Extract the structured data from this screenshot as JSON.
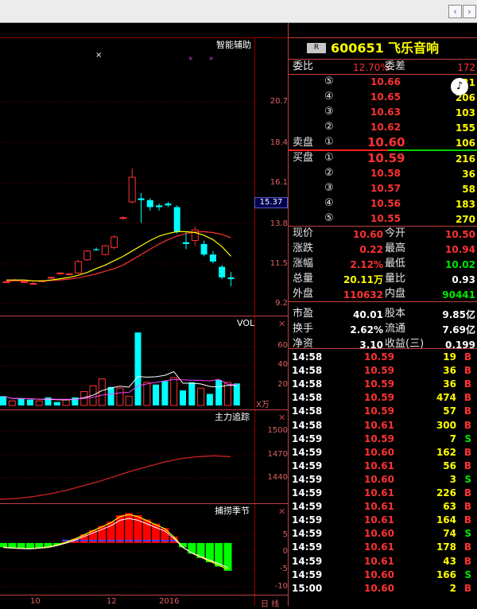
{
  "window": {
    "nav_back": "‹",
    "nav_forward": "›"
  },
  "chart_panels": {
    "main": {
      "title": "智能辅助",
      "ylabels": [
        "20.7",
        "18.4",
        "16.1",
        "13.8",
        "11.5",
        "9.2"
      ],
      "current_price_tag": "15.37",
      "marker": "×",
      "stars": [
        "*",
        "*"
      ]
    },
    "vol": {
      "title": "VOL",
      "ylabels": [
        "60",
        "40",
        "20"
      ],
      "unit": "X万"
    },
    "main_tracking": {
      "title": "主力追踪",
      "ylabels": [
        "1500",
        "1470",
        "1440"
      ]
    },
    "season": {
      "title": "捕捞季节",
      "ylabels": [
        "5",
        "0",
        "-5",
        "-10"
      ]
    },
    "close_glyph": "✕",
    "xlabels": [
      "10",
      "12",
      "2016"
    ],
    "period": "日 线"
  },
  "chart_data": [
    {
      "type": "candlestick",
      "title": "智能辅助",
      "ylim": [
        9.2,
        20.7
      ],
      "candles": [
        {
          "o": 10.45,
          "c": 10.45,
          "h": 10.5,
          "l": 10.4
        },
        {
          "o": 10.55,
          "c": 10.55,
          "h": 10.6,
          "l": 10.5
        },
        {
          "o": 10.45,
          "c": 10.45,
          "h": 10.5,
          "l": 10.4
        },
        {
          "o": 10.35,
          "c": 10.35,
          "h": 10.45,
          "l": 10.3
        },
        {
          "o": 10.5,
          "c": 10.5,
          "h": 10.55,
          "l": 10.45
        },
        {
          "o": 10.65,
          "c": 10.7,
          "h": 10.75,
          "l": 10.6
        },
        {
          "o": 10.9,
          "c": 10.95,
          "h": 11.0,
          "l": 10.85
        },
        {
          "o": 10.9,
          "c": 10.9,
          "h": 10.95,
          "l": 10.85
        },
        {
          "o": 10.95,
          "c": 11.6,
          "h": 11.7,
          "l": 10.9
        },
        {
          "o": 11.7,
          "c": 12.2,
          "h": 12.25,
          "l": 11.65
        },
        {
          "o": 12.3,
          "c": 12.25,
          "h": 12.4,
          "l": 12.2
        },
        {
          "o": 12.0,
          "c": 12.5,
          "h": 12.55,
          "l": 11.95
        },
        {
          "o": 12.4,
          "c": 13.0,
          "h": 13.1,
          "l": 12.3
        },
        {
          "o": 14.1,
          "c": 14.1,
          "h": 14.2,
          "l": 14.0
        },
        {
          "o": 15.0,
          "c": 16.4,
          "h": 16.9,
          "l": 14.9
        },
        {
          "o": 15.2,
          "c": 15.1,
          "h": 15.5,
          "l": 13.8
        },
        {
          "o": 15.1,
          "c": 14.7,
          "h": 15.2,
          "l": 14.5
        },
        {
          "o": 14.8,
          "c": 14.7,
          "h": 14.9,
          "l": 14.5
        },
        {
          "o": 14.9,
          "c": 14.8,
          "h": 15.0,
          "l": 14.7
        },
        {
          "o": 14.7,
          "c": 13.3,
          "h": 14.8,
          "l": 13.2
        },
        {
          "o": 12.7,
          "c": 12.6,
          "h": 13.3,
          "l": 12.3
        },
        {
          "o": 12.8,
          "c": 13.4,
          "h": 13.6,
          "l": 12.5
        },
        {
          "o": 12.6,
          "c": 12.0,
          "h": 12.8,
          "l": 11.9
        },
        {
          "o": 12.0,
          "c": 11.6,
          "h": 12.2,
          "l": 11.5
        },
        {
          "o": 11.3,
          "c": 10.7,
          "h": 11.4,
          "l": 10.6
        },
        {
          "o": 10.7,
          "c": 10.6,
          "h": 11.0,
          "l": 10.2
        }
      ],
      "ma_short": [
        10.55,
        10.55,
        10.55,
        10.5,
        10.5,
        10.55,
        10.62,
        10.7,
        10.82,
        10.98,
        11.2,
        11.4,
        11.65,
        11.9,
        12.2,
        12.5,
        12.8,
        13.05,
        13.2,
        13.3,
        13.3,
        13.25,
        13.1,
        12.85,
        12.45,
        11.9
      ],
      "ma_long": [
        10.5,
        10.5,
        10.5,
        10.5,
        10.5,
        10.52,
        10.55,
        10.6,
        10.68,
        10.78,
        10.9,
        11.05,
        11.2,
        11.4,
        11.7,
        12.0,
        12.3,
        12.6,
        12.85,
        13.05,
        13.2,
        13.28,
        13.3,
        13.25,
        13.15,
        12.95
      ]
    },
    {
      "type": "bar",
      "title": "VOL",
      "unit": "X万",
      "ylim": [
        0,
        70
      ],
      "values": [
        8,
        4,
        6,
        5,
        4,
        7,
        3,
        5,
        7,
        12,
        17,
        23,
        16,
        15,
        8,
        63,
        20,
        18,
        21,
        24,
        13,
        20,
        15,
        10,
        22,
        20,
        19
      ]
    },
    {
      "type": "line",
      "title": "主力追踪",
      "ylim": [
        1415,
        1510
      ],
      "values": [
        1415,
        1416,
        1418,
        1421,
        1425,
        1430,
        1435,
        1441,
        1447,
        1452,
        1457,
        1461,
        1463,
        1464,
        1463
      ]
    },
    {
      "type": "bar",
      "title": "捕捞季节",
      "ylim": [
        -11,
        8
      ],
      "values": [
        -1.0,
        -1.2,
        -1.3,
        -1.4,
        -1.2,
        -1.0,
        -0.5,
        0.2,
        1.0,
        2.0,
        3.0,
        4.0,
        5.0,
        6.5,
        7.0,
        6.5,
        5.5,
        4.5,
        3.5,
        1.5,
        -1.0,
        -2.5,
        -3.5,
        -4.5,
        -5.5,
        -6.5
      ]
    }
  ],
  "quote": {
    "badge": "R",
    "code": "600651",
    "name": "飞乐音响",
    "ratio_label": "委比",
    "ratio_value": "12.70%",
    "diff_label": "委差",
    "diff_value": "172",
    "sell_label": "卖盘",
    "buy_label": "买盘",
    "sells": [
      {
        "n": "⑤",
        "price": "10.66",
        "vol": "31"
      },
      {
        "n": "④",
        "price": "10.65",
        "vol": "206"
      },
      {
        "n": "③",
        "price": "10.63",
        "vol": "103"
      },
      {
        "n": "②",
        "price": "10.62",
        "vol": "155"
      },
      {
        "n": "①",
        "price": "10.60",
        "vol": "106"
      }
    ],
    "buys": [
      {
        "n": "①",
        "price": "10.59",
        "vol": "216"
      },
      {
        "n": "②",
        "price": "10.58",
        "vol": "36"
      },
      {
        "n": "③",
        "price": "10.57",
        "vol": "58"
      },
      {
        "n": "④",
        "price": "10.56",
        "vol": "183"
      },
      {
        "n": "⑤",
        "price": "10.55",
        "vol": "270"
      }
    ],
    "stats_left": [
      {
        "label": "现价",
        "value": "10.60",
        "color": "red"
      },
      {
        "label": "涨跌",
        "value": "0.22",
        "color": "red"
      },
      {
        "label": "涨幅",
        "value": "2.12%",
        "color": "red"
      },
      {
        "label": "总量",
        "value": "20.11万",
        "color": "yel"
      },
      {
        "label": "外盘",
        "value": "110632",
        "color": "red"
      },
      {
        "label": "市盈",
        "value": "40.01",
        "color": "wht"
      },
      {
        "label": "换手",
        "value": "2.62%",
        "color": "wht"
      },
      {
        "label": "净资",
        "value": "3.10",
        "color": "wht"
      }
    ],
    "stats_right": [
      {
        "label": "今开",
        "value": "10.50",
        "color": "red"
      },
      {
        "label": "最高",
        "value": "10.94",
        "color": "red"
      },
      {
        "label": "最低",
        "value": "10.02",
        "color": "grn"
      },
      {
        "label": "量比",
        "value": "0.93",
        "color": "wht"
      },
      {
        "label": "内盘",
        "value": "90441",
        "color": "grn"
      },
      {
        "label": "股本",
        "value": "9.85亿",
        "color": "wht"
      },
      {
        "label": "流通",
        "value": "7.69亿",
        "color": "wht"
      },
      {
        "label": "收益(三)",
        "value": "0.199",
        "color": "wht"
      }
    ]
  },
  "ticks": [
    {
      "time": "14:58",
      "price": "10.59",
      "vol": "19",
      "side": "B"
    },
    {
      "time": "14:58",
      "price": "10.59",
      "vol": "36",
      "side": "B"
    },
    {
      "time": "14:58",
      "price": "10.59",
      "vol": "36",
      "side": "B"
    },
    {
      "time": "14:58",
      "price": "10.59",
      "vol": "474",
      "side": "B"
    },
    {
      "time": "14:58",
      "price": "10.59",
      "vol": "57",
      "side": "B"
    },
    {
      "time": "14:58",
      "price": "10.61",
      "vol": "300",
      "side": "B"
    },
    {
      "time": "14:59",
      "price": "10.59",
      "vol": "7",
      "side": "S"
    },
    {
      "time": "14:59",
      "price": "10.60",
      "vol": "162",
      "side": "B"
    },
    {
      "time": "14:59",
      "price": "10.61",
      "vol": "56",
      "side": "B"
    },
    {
      "time": "14:59",
      "price": "10.60",
      "vol": "3",
      "side": "S"
    },
    {
      "time": "14:59",
      "price": "10.61",
      "vol": "226",
      "side": "B"
    },
    {
      "time": "14:59",
      "price": "10.61",
      "vol": "63",
      "side": "B"
    },
    {
      "time": "14:59",
      "price": "10.61",
      "vol": "164",
      "side": "B"
    },
    {
      "time": "14:59",
      "price": "10.60",
      "vol": "74",
      "side": "S"
    },
    {
      "time": "14:59",
      "price": "10.61",
      "vol": "178",
      "side": "B"
    },
    {
      "time": "14:59",
      "price": "10.61",
      "vol": "43",
      "side": "B"
    },
    {
      "time": "14:59",
      "price": "10.60",
      "vol": "166",
      "side": "S"
    },
    {
      "time": "15:00",
      "price": "10.60",
      "vol": "2",
      "side": "B"
    }
  ],
  "colors": {
    "up": "#ff3232",
    "down": "#00ffff",
    "grid": "#8b0000",
    "ma_short": "#ffff00",
    "ma_long": "#ff3030"
  }
}
